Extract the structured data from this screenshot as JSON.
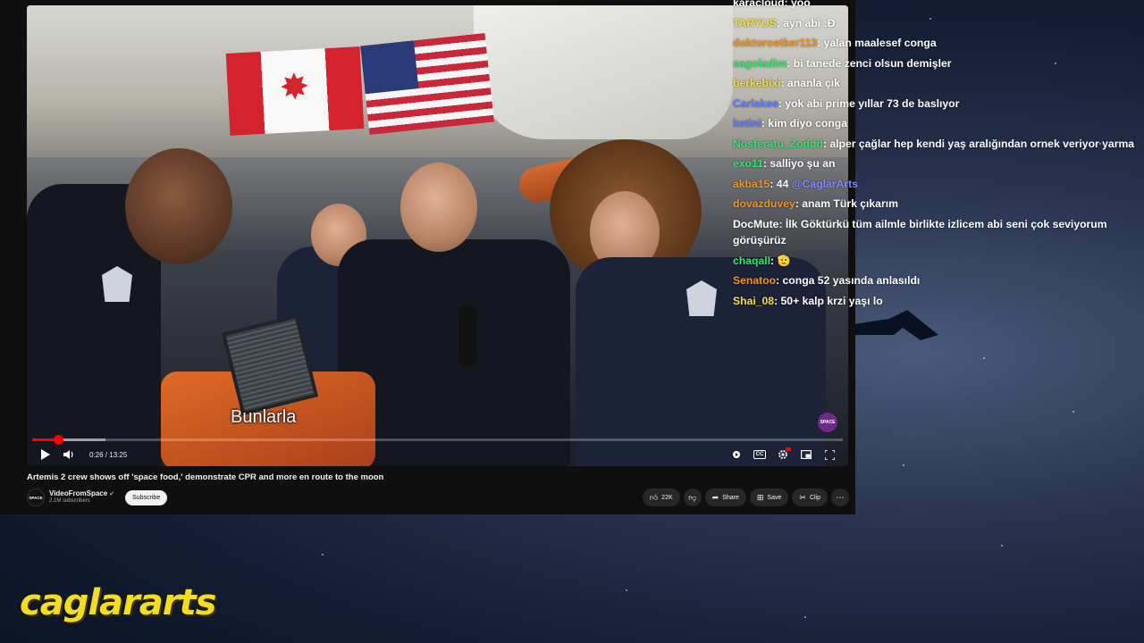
{
  "video": {
    "caption": "Bunlarla",
    "current_time": "0:26",
    "duration": "13:25",
    "separator": " / ",
    "progress_fraction": 0.032,
    "badge": "SPACE"
  },
  "video_info": {
    "title": "Artemis 2 crew shows off 'space food,' demonstrate CPR and more en route to the moon",
    "channel_name": "VideoFromSpace",
    "channel_avatar_text": "SPACE",
    "subscribers": "2.1M subscribers",
    "subscribe_label": "Subscribe",
    "like_count": "22K",
    "share_label": "Share",
    "save_label": "Save",
    "clip_label": "Clip"
  },
  "chat": [
    {
      "user": "karacloud",
      "color": "#ffffff",
      "text": ": yoo"
    },
    {
      "user": "TARYUS",
      "color": "#f2dd3c",
      "text": ": ayn abi :Ɖ"
    },
    {
      "user": "doktoroetker113",
      "color": "#f0941e",
      "text": ": yalan maalesef conga"
    },
    {
      "user": "sagoladim",
      "color": "#2ee86b",
      "text": ": bi tanede zenci olsun demişler"
    },
    {
      "user": "berkebixi",
      "color": "#f2dd3c",
      "text": ": ananla çık"
    },
    {
      "user": "Carlakee",
      "color": "#5b7bff",
      "text": ": yok abi prime yıllar 73 de baslıyor"
    },
    {
      "user": "ketini",
      "color": "#5b7bff",
      "text": ": kim diyo conga"
    },
    {
      "user": "Nosferatu_Zoddd",
      "color": "#2ee86b",
      "text": ": alper çağlar hep kendi yaş aralığından ornek veriyor yarma"
    },
    {
      "user": "exo11",
      "color": "#2ee86b",
      "text": ": salliyo şu an"
    },
    {
      "user": "akba15",
      "color": "#f0941e",
      "text": ": 44 ",
      "mention": "@CaglarArts"
    },
    {
      "user": "dovazduvey",
      "color": "#f0941e",
      "text": ": anam Türk çıkarım"
    },
    {
      "user": "DocMute",
      "color": "#ffffff",
      "text": ": İlk Göktürkü tüm ailmle birlikte izlicem abi seni çok seviyorum görüşürüz",
      "wrap": true
    },
    {
      "user": "chaqall",
      "color": "#2ee86b",
      "text": ": 🫡"
    },
    {
      "user": "Senatoo",
      "color": "#f0941e",
      "text": ": conga 52 yasında anlasıldı"
    },
    {
      "user": "Shai_08",
      "color": "#f2dd3c",
      "text": ": 50+ kalp krzi yaşı lo"
    }
  ],
  "logo": "caglararts",
  "icons": {
    "play": "play-icon",
    "volume": "volume-icon",
    "autoplay": "autoplay-icon",
    "captions": "captions-icon",
    "settings": "settings-icon",
    "miniplayer": "miniplayer-icon",
    "fullscreen": "fullscreen-icon",
    "like": "thumbs-up-icon",
    "dislike": "thumbs-down-icon",
    "share": "share-icon",
    "save": "save-icon",
    "clip": "scissors-icon",
    "more": "more-icon"
  },
  "colors": {
    "progress": "#ff0000",
    "logo": "#f4dc22",
    "mention": "#7f8bff"
  }
}
